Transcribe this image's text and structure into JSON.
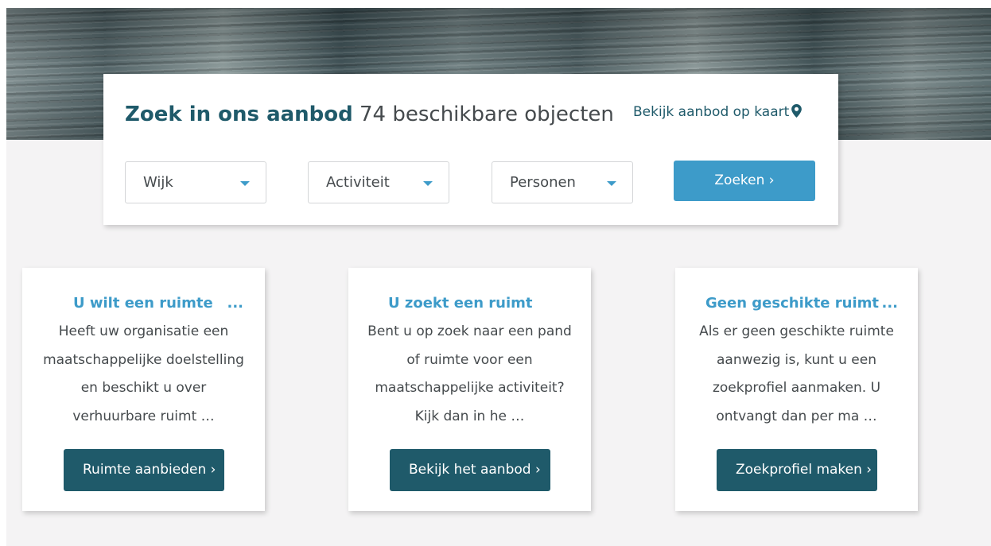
{
  "search": {
    "title_strong": "Zoek in ons aanbod",
    "title_count": "74 beschikbare objecten",
    "map_link": "Bekijk aanbod op kaart",
    "map_icon": "map-marker-icon",
    "filters": [
      {
        "label": "Wijk"
      },
      {
        "label": "Activiteit"
      },
      {
        "label": "Personen"
      }
    ],
    "submit_label": "Zoeken ›"
  },
  "cards": [
    {
      "title": "U wilt een ruimte",
      "title_ellipsis": "...",
      "text": "Heeft uw organisatie een maatschappelijke doelstelling en beschikt u over verhuurbare ruimt …",
      "button": "Ruimte aanbieden ›"
    },
    {
      "title": "U zoekt een ruimt",
      "title_ellipsis": "",
      "text": "Bent u op zoek naar een pand of ruimte voor een maatschappelijke activiteit? Kijk dan in he …",
      "button": "Bekijk het aanbod ›"
    },
    {
      "title": "Geen geschikte ruimt",
      "title_ellipsis": "...",
      "text": "Als er geen geschikte ruimte aanwezig is, kunt u een zoekprofiel aanmaken. U ontvangt dan per ma …",
      "button": "Zoekprofiel maken ›"
    }
  ],
  "colors": {
    "primary_dark": "#1f5a6a",
    "accent_blue": "#3d9bc9",
    "background": "#f4f3f4"
  }
}
